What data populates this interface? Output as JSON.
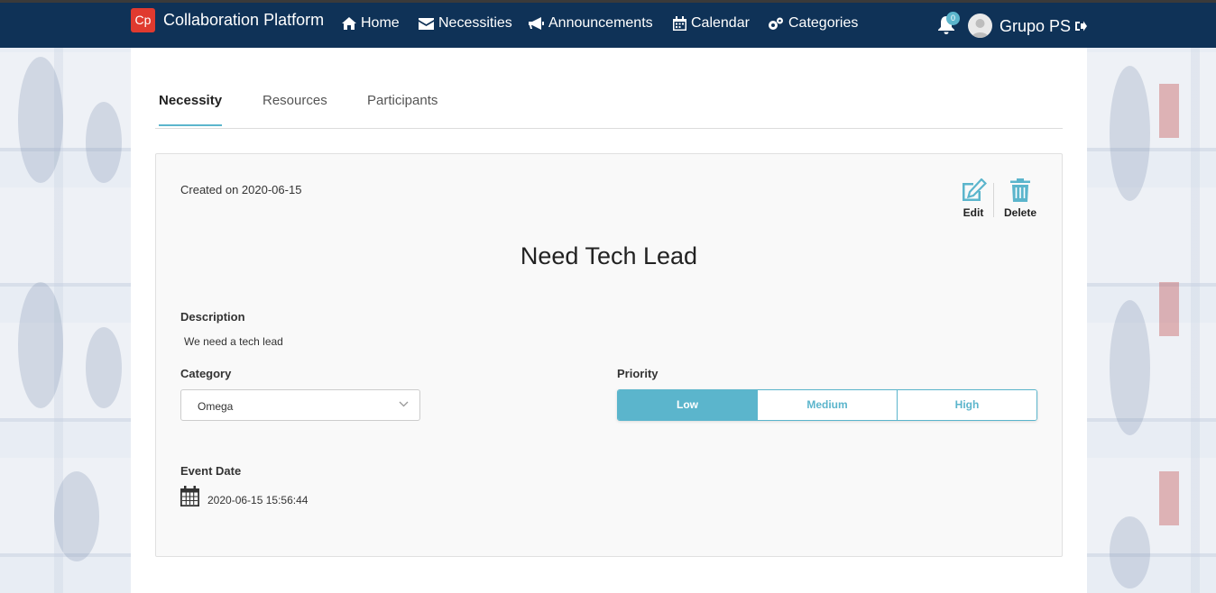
{
  "brand": {
    "logo_text": "Cp",
    "name": "Collaboration Platform"
  },
  "nav": {
    "home": "Home",
    "necessities": "Necessities",
    "announcements": "Announcements",
    "calendar": "Calendar",
    "categories": "Categories"
  },
  "notifications": {
    "count": "0"
  },
  "user": {
    "name": "Grupo PS"
  },
  "tabs": [
    {
      "label": "Necessity"
    },
    {
      "label": "Resources"
    },
    {
      "label": "Participants"
    }
  ],
  "necessity": {
    "created": "Created on 2020-06-15",
    "title": "Need Tech Lead",
    "description_label": "Description",
    "description": "We need a tech lead",
    "category_label": "Category",
    "category_value": "Omega",
    "priority_label": "Priority",
    "priority_options": [
      "Low",
      "Medium",
      "High"
    ],
    "priority_selected": "Low",
    "event_date_label": "Event Date",
    "event_date": "2020-06-15 15:56:44"
  },
  "actions": {
    "edit": "Edit",
    "delete": "Delete"
  },
  "colors": {
    "navbar": "#0f3257",
    "accent": "#5bb5cc",
    "logo": "#e03a2f"
  }
}
